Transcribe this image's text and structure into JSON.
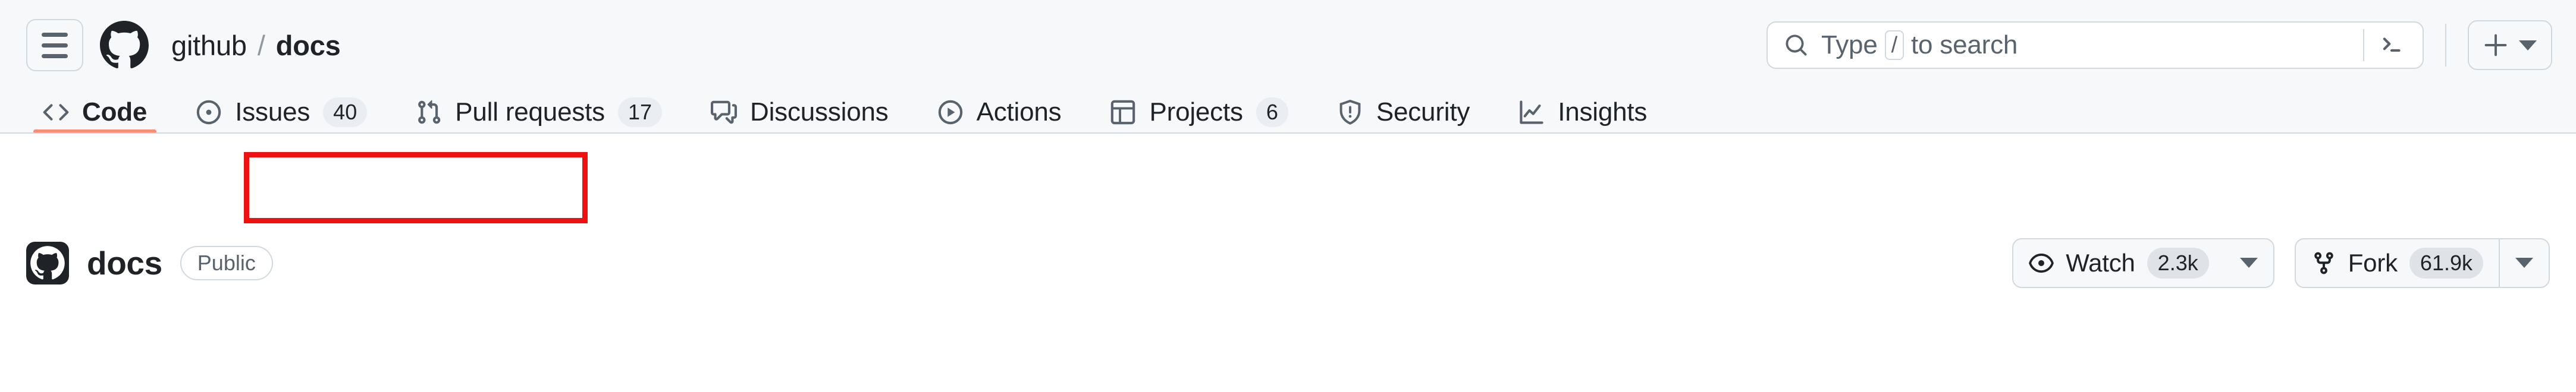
{
  "appbar": {
    "menu_icon": "hamburger-menu-icon",
    "logo_icon": "github-logo-icon",
    "breadcrumb": {
      "owner": "github",
      "separator": "/",
      "repo": "docs"
    },
    "search": {
      "icon": "search-icon",
      "placeholder_prefix": "Type",
      "placeholder_key": "/",
      "placeholder_suffix": "to search",
      "command_palette_icon": "terminal-prompt-icon"
    },
    "create": {
      "plus_icon": "plus-icon",
      "caret_icon": "chevron-down-icon"
    }
  },
  "tabs": [
    {
      "label": "Code",
      "icon": "code-icon",
      "count": null,
      "active": true
    },
    {
      "label": "Issues",
      "icon": "issue-opened-icon",
      "count": "40",
      "active": false
    },
    {
      "label": "Pull requests",
      "icon": "git-pull-request-icon",
      "count": "17",
      "active": false
    },
    {
      "label": "Discussions",
      "icon": "comment-discussion-icon",
      "count": null,
      "active": false
    },
    {
      "label": "Actions",
      "icon": "play-circle-icon",
      "count": null,
      "active": false
    },
    {
      "label": "Projects",
      "icon": "table-icon",
      "count": "6",
      "active": false
    },
    {
      "label": "Security",
      "icon": "shield-icon",
      "count": null,
      "active": false
    },
    {
      "label": "Insights",
      "icon": "graph-icon",
      "count": null,
      "active": false
    }
  ],
  "repo": {
    "avatar_icon": "github-repo-avatar-icon",
    "name": "docs",
    "visibility": "Public",
    "watch": {
      "label": "Watch",
      "count": "2.3k",
      "icon": "eye-icon",
      "caret_icon": "chevron-down-icon"
    },
    "fork": {
      "label": "Fork",
      "count": "61.9k",
      "icon": "repo-forked-icon",
      "caret_icon": "chevron-down-icon"
    }
  },
  "annotation": {
    "highlight_target": "Issues",
    "highlight_color": "#ee1111"
  },
  "colors": {
    "header_background": "#f6f8fa",
    "page_background": "#ffffff",
    "border": "#d1d9e0",
    "text_primary": "#1f2328",
    "text_muted": "#59636e",
    "counter_background": "#eaeef2",
    "active_tab_underline": "#fd8c73"
  }
}
